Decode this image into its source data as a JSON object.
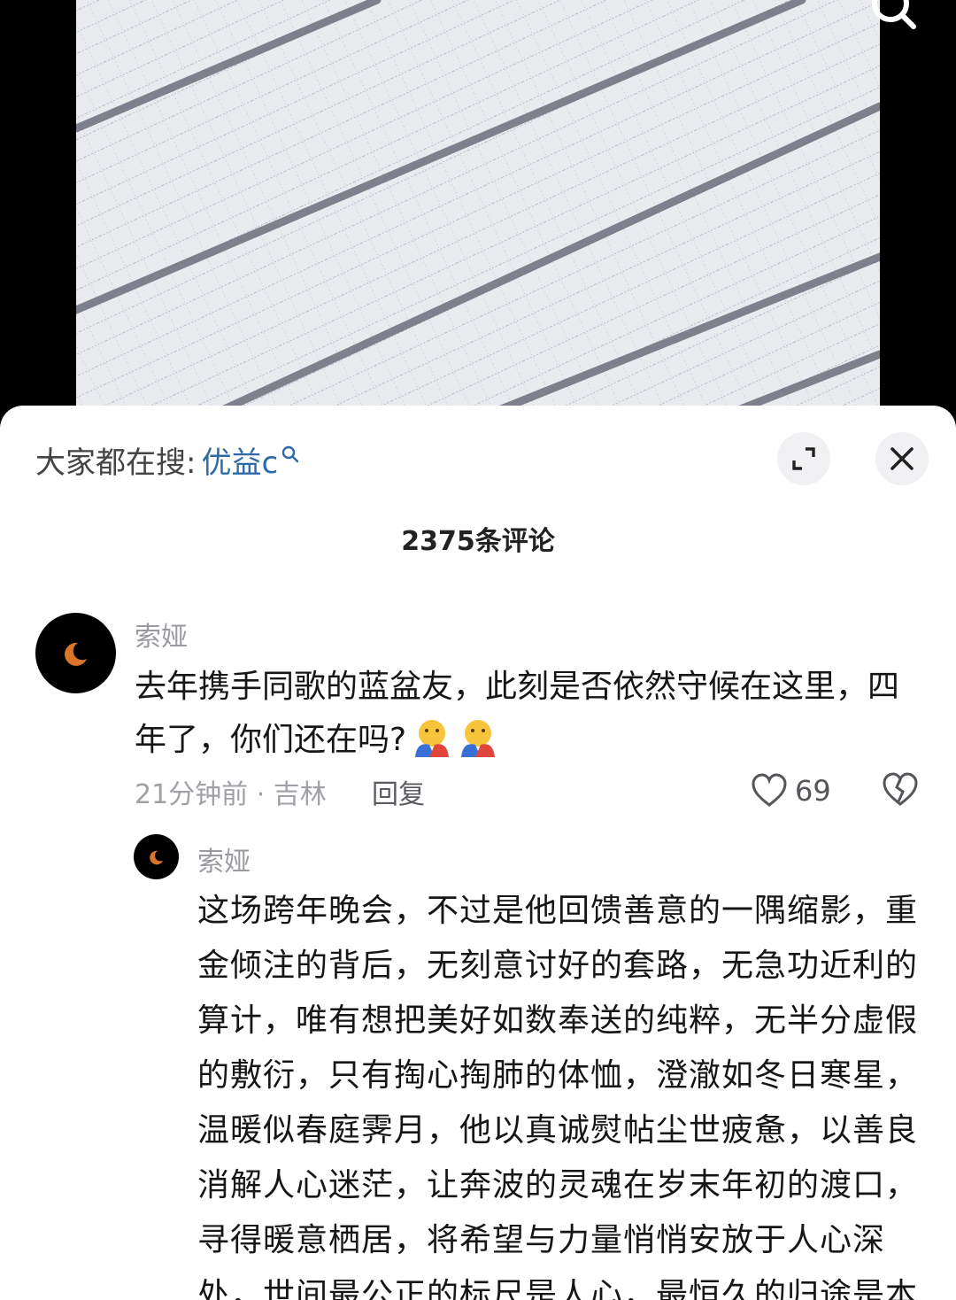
{
  "search": {
    "prefix": "大家都在搜:",
    "keyword": "优益c"
  },
  "comments_count": "2375条评论",
  "comment": {
    "author": "索娅",
    "text": "去年携手同歌的蓝盆友，此刻是否依然守候在这里，四年了，你们还在吗?",
    "time_location": "21分钟前 · 吉林",
    "reply_label": "回复",
    "likes": "69"
  },
  "reply": {
    "author": "索娅",
    "text": "这场跨年晚会，不过是他回馈善意的一隅缩影，重金倾注的背后，无刻意讨好的套路，无急功近利的算计，唯有想把美好如数奉送的纯粹，无半分虚假的敷衍，只有掏心掏肺的体恤，澄澈如冬日寒星，温暖似春庭霁月，他以真诚熨帖尘世疲惫，以善良消解人心迷茫，让奔波的灵魂在岁末年初的渡口，寻得暖意栖居，将希望与力量悄悄安放于人心深处，世间最公正的标尺是人心，最恒久的归途是本"
  },
  "icons": {
    "search": "search-icon",
    "expand": "expand-icon",
    "close": "close-icon",
    "like": "heart-icon",
    "dislike": "broken-heart-icon",
    "emoji": "hugging-emoji"
  },
  "colors": {
    "keyword": "#2f6aa8",
    "sheet_bg": "#ffffff",
    "muted": "#9a9aa0"
  }
}
